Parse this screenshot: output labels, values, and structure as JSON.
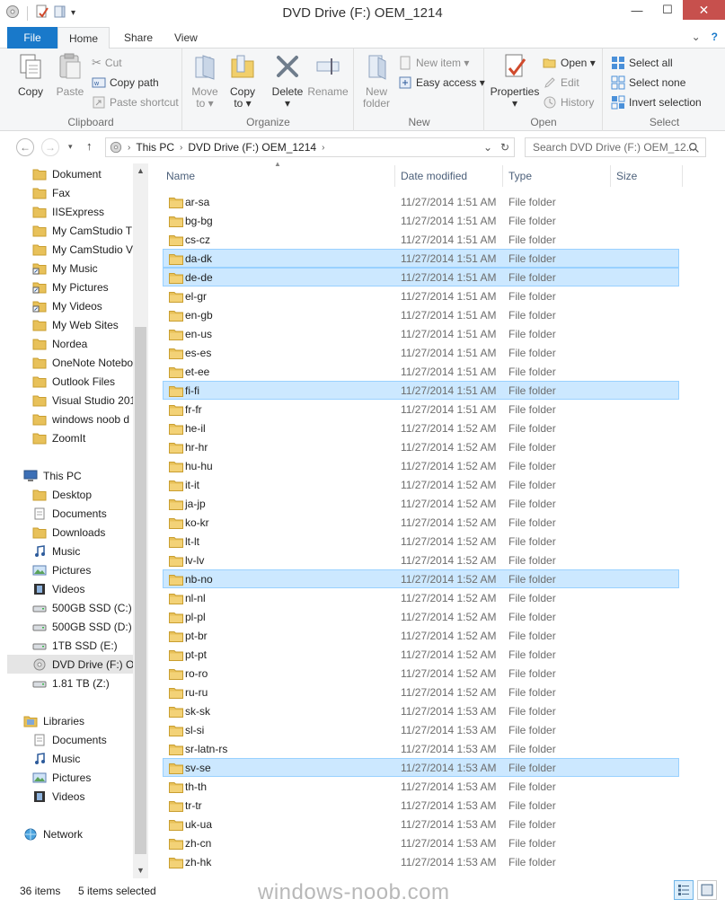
{
  "window": {
    "title": "DVD Drive (F:) OEM_1214",
    "minimize": "—",
    "maximize": "☐",
    "close": "✕"
  },
  "ribbon_tabs": {
    "file": "File",
    "home": "Home",
    "share": "Share",
    "view": "View",
    "expand": "⌄",
    "help": "?"
  },
  "ribbon": {
    "clipboard": {
      "label": "Clipboard",
      "copy": "Copy",
      "paste": "Paste",
      "cut": "Cut",
      "copy_path": "Copy path",
      "paste_shortcut": "Paste shortcut"
    },
    "organize": {
      "label": "Organize",
      "move_to_line1": "Move",
      "move_to_line2": "to ▾",
      "copy_to_line1": "Copy",
      "copy_to_line2": "to ▾",
      "delete_line1": "Delete",
      "delete_line2": "▾",
      "rename": "Rename"
    },
    "new": {
      "label": "New",
      "new_folder_line1": "New",
      "new_folder_line2": "folder",
      "new_item": "New item ▾",
      "easy_access": "Easy access ▾"
    },
    "open": {
      "label": "Open",
      "properties": "Properties",
      "properties_arrow": "▾",
      "open": "Open ▾",
      "edit": "Edit",
      "history": "History"
    },
    "select": {
      "label": "Select",
      "select_all": "Select all",
      "select_none": "Select none",
      "invert_selection": "Invert selection"
    }
  },
  "address": {
    "back": "←",
    "forward": "→",
    "up": "↑",
    "segments": [
      "This PC",
      "DVD Drive (F:) OEM_1214"
    ],
    "dropdown": "⌄",
    "refresh": "↻",
    "search_placeholder": "Search DVD Drive (F:) OEM_12..."
  },
  "nav_pane": {
    "favorites": [
      "Dokument",
      "Fax",
      "IISExpress",
      "My CamStudio T",
      "My CamStudio V",
      "My Music",
      "My Pictures",
      "My Videos",
      "My Web Sites",
      "Nordea",
      "OneNote Notebo",
      "Outlook Files",
      "Visual Studio 201",
      "windows noob d",
      "ZoomIt"
    ],
    "this_pc": "This PC",
    "pc_items": [
      "Desktop",
      "Documents",
      "Downloads",
      "Music",
      "Pictures",
      "Videos",
      "500GB SSD (C:)",
      "500GB SSD (D:)",
      "1TB SSD (E:)",
      "DVD Drive (F:) OE",
      "1.81 TB (Z:)"
    ],
    "libraries": "Libraries",
    "library_items": [
      "Documents",
      "Music",
      "Pictures",
      "Videos"
    ],
    "network": "Network"
  },
  "columns": {
    "name": "Name",
    "date_modified": "Date modified",
    "type": "Type",
    "size": "Size"
  },
  "files": [
    {
      "name": "ar-sa",
      "date": "11/27/2014 1:51 AM",
      "type": "File folder",
      "selected": false
    },
    {
      "name": "bg-bg",
      "date": "11/27/2014 1:51 AM",
      "type": "File folder",
      "selected": false
    },
    {
      "name": "cs-cz",
      "date": "11/27/2014 1:51 AM",
      "type": "File folder",
      "selected": false
    },
    {
      "name": "da-dk",
      "date": "11/27/2014 1:51 AM",
      "type": "File folder",
      "selected": true
    },
    {
      "name": "de-de",
      "date": "11/27/2014 1:51 AM",
      "type": "File folder",
      "selected": true
    },
    {
      "name": "el-gr",
      "date": "11/27/2014 1:51 AM",
      "type": "File folder",
      "selected": false
    },
    {
      "name": "en-gb",
      "date": "11/27/2014 1:51 AM",
      "type": "File folder",
      "selected": false
    },
    {
      "name": "en-us",
      "date": "11/27/2014 1:51 AM",
      "type": "File folder",
      "selected": false
    },
    {
      "name": "es-es",
      "date": "11/27/2014 1:51 AM",
      "type": "File folder",
      "selected": false
    },
    {
      "name": "et-ee",
      "date": "11/27/2014 1:51 AM",
      "type": "File folder",
      "selected": false
    },
    {
      "name": "fi-fi",
      "date": "11/27/2014 1:51 AM",
      "type": "File folder",
      "selected": true
    },
    {
      "name": "fr-fr",
      "date": "11/27/2014 1:51 AM",
      "type": "File folder",
      "selected": false
    },
    {
      "name": "he-il",
      "date": "11/27/2014 1:52 AM",
      "type": "File folder",
      "selected": false
    },
    {
      "name": "hr-hr",
      "date": "11/27/2014 1:52 AM",
      "type": "File folder",
      "selected": false
    },
    {
      "name": "hu-hu",
      "date": "11/27/2014 1:52 AM",
      "type": "File folder",
      "selected": false
    },
    {
      "name": "it-it",
      "date": "11/27/2014 1:52 AM",
      "type": "File folder",
      "selected": false
    },
    {
      "name": "ja-jp",
      "date": "11/27/2014 1:52 AM",
      "type": "File folder",
      "selected": false
    },
    {
      "name": "ko-kr",
      "date": "11/27/2014 1:52 AM",
      "type": "File folder",
      "selected": false
    },
    {
      "name": "lt-lt",
      "date": "11/27/2014 1:52 AM",
      "type": "File folder",
      "selected": false
    },
    {
      "name": "lv-lv",
      "date": "11/27/2014 1:52 AM",
      "type": "File folder",
      "selected": false
    },
    {
      "name": "nb-no",
      "date": "11/27/2014 1:52 AM",
      "type": "File folder",
      "selected": true
    },
    {
      "name": "nl-nl",
      "date": "11/27/2014 1:52 AM",
      "type": "File folder",
      "selected": false
    },
    {
      "name": "pl-pl",
      "date": "11/27/2014 1:52 AM",
      "type": "File folder",
      "selected": false
    },
    {
      "name": "pt-br",
      "date": "11/27/2014 1:52 AM",
      "type": "File folder",
      "selected": false
    },
    {
      "name": "pt-pt",
      "date": "11/27/2014 1:52 AM",
      "type": "File folder",
      "selected": false
    },
    {
      "name": "ro-ro",
      "date": "11/27/2014 1:52 AM",
      "type": "File folder",
      "selected": false
    },
    {
      "name": "ru-ru",
      "date": "11/27/2014 1:52 AM",
      "type": "File folder",
      "selected": false
    },
    {
      "name": "sk-sk",
      "date": "11/27/2014 1:53 AM",
      "type": "File folder",
      "selected": false
    },
    {
      "name": "sl-si",
      "date": "11/27/2014 1:53 AM",
      "type": "File folder",
      "selected": false
    },
    {
      "name": "sr-latn-rs",
      "date": "11/27/2014 1:53 AM",
      "type": "File folder",
      "selected": false
    },
    {
      "name": "sv-se",
      "date": "11/27/2014 1:53 AM",
      "type": "File folder",
      "selected": true
    },
    {
      "name": "th-th",
      "date": "11/27/2014 1:53 AM",
      "type": "File folder",
      "selected": false
    },
    {
      "name": "tr-tr",
      "date": "11/27/2014 1:53 AM",
      "type": "File folder",
      "selected": false
    },
    {
      "name": "uk-ua",
      "date": "11/27/2014 1:53 AM",
      "type": "File folder",
      "selected": false
    },
    {
      "name": "zh-cn",
      "date": "11/27/2014 1:53 AM",
      "type": "File folder",
      "selected": false
    },
    {
      "name": "zh-hk",
      "date": "11/27/2014 1:53 AM",
      "type": "File folder",
      "selected": false
    }
  ],
  "status": {
    "item_count": "36 items",
    "selected_count": "5 items selected",
    "watermark": "windows-noob.com"
  },
  "colors": {
    "accent": "#1979ca",
    "selection_bg": "#cce8ff",
    "selection_border": "#99d1ff",
    "folder": "#e8c15a",
    "close_button": "#c7504d"
  }
}
